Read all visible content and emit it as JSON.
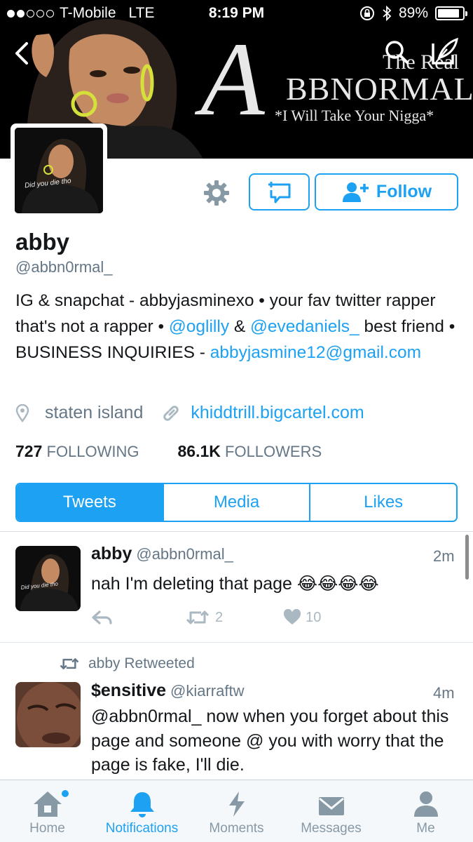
{
  "status_bar": {
    "carrier": "T-Mobile",
    "network": "LTE",
    "time": "8:19 PM",
    "battery": "89%",
    "battery_level": 0.89,
    "signal_bars_filled": 2,
    "signal_bars_total": 5
  },
  "banner": {
    "line_the_real": "The Real",
    "big_letter": "A",
    "title_rest": "BBNORMAL",
    "tagline": "*I Will Take Your Nigga*",
    "avatar_shirt_text": "Did you die tho"
  },
  "actions": {
    "follow_label": "Follow"
  },
  "profile": {
    "name": "abby",
    "handle": "@abbn0rmal_",
    "bio_part1": "IG & snapchat - abbyjasminexo • your fav twitter rapper that's not a rapper • ",
    "bio_link1": "@oglilly",
    "bio_part2": " & ",
    "bio_link2": "@evedaniels_",
    "bio_part3": " best friend • BUSINESS INQUIRIES - ",
    "bio_link3": "abbyjasmine12@gmail.com",
    "location": "staten island",
    "website": "khiddtrill.bigcartel.com",
    "following_count": "727",
    "following_label": "FOLLOWING",
    "followers_count": "86.1K",
    "followers_label": "FOLLOWERS"
  },
  "tabs": [
    {
      "label": "Tweets",
      "active": true
    },
    {
      "label": "Media",
      "active": false
    },
    {
      "label": "Likes",
      "active": false
    }
  ],
  "tweets": [
    {
      "name": "abby",
      "handle": "@abbn0rmal_",
      "time": "2m",
      "text": "nah I'm deleting that page 😂😂😂😂",
      "retweets": "2",
      "likes": "10"
    },
    {
      "retweeted_by": "abby Retweeted",
      "name": "$ensitive",
      "handle": "@kiarraftw",
      "time": "4m",
      "text": "@abbn0rmal_ now when you forget about this page and someone @ you with worry that the page is fake, I'll die."
    }
  ],
  "bottom_nav": [
    {
      "label": "Home",
      "icon": "home-icon",
      "active": false
    },
    {
      "label": "Notifications",
      "icon": "bell-icon",
      "active": true
    },
    {
      "label": "Moments",
      "icon": "lightning-icon",
      "active": false
    },
    {
      "label": "Messages",
      "icon": "envelope-icon",
      "active": false
    },
    {
      "label": "Me",
      "icon": "person-icon",
      "active": false
    }
  ],
  "colors": {
    "accent": "#1da1f2",
    "muted": "#657786",
    "nav_inactive": "#8899a6"
  }
}
